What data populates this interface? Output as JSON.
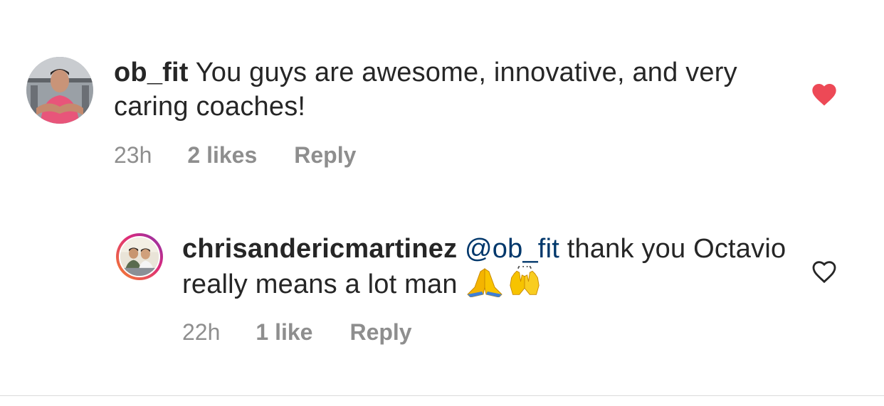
{
  "comments": [
    {
      "username": "ob_fit",
      "mention": "",
      "text": "You guys are awesome, innovative, and very caring coaches!",
      "time": "23h",
      "likes": "2 likes",
      "reply": "Reply",
      "liked": true,
      "avatar_icon": "avatar-photo-man-pink-shirt"
    },
    {
      "username": "chrisandericmartinez",
      "mention": "@ob_fit",
      "text": "thank you Octavio really means a lot man",
      "emojis": [
        "folded-hands-emoji",
        "raising-hands-emoji"
      ],
      "time": "22h",
      "likes": "1 like",
      "reply": "Reply",
      "liked": false,
      "avatar_icon": "avatar-photo-two-men"
    }
  ],
  "colors": {
    "text": "#262626",
    "meta": "#8e8e8e",
    "mention": "#00376b",
    "heart_liked": "#ed4956",
    "heart_outline": "#262626",
    "divider": "#dbdbdb"
  }
}
